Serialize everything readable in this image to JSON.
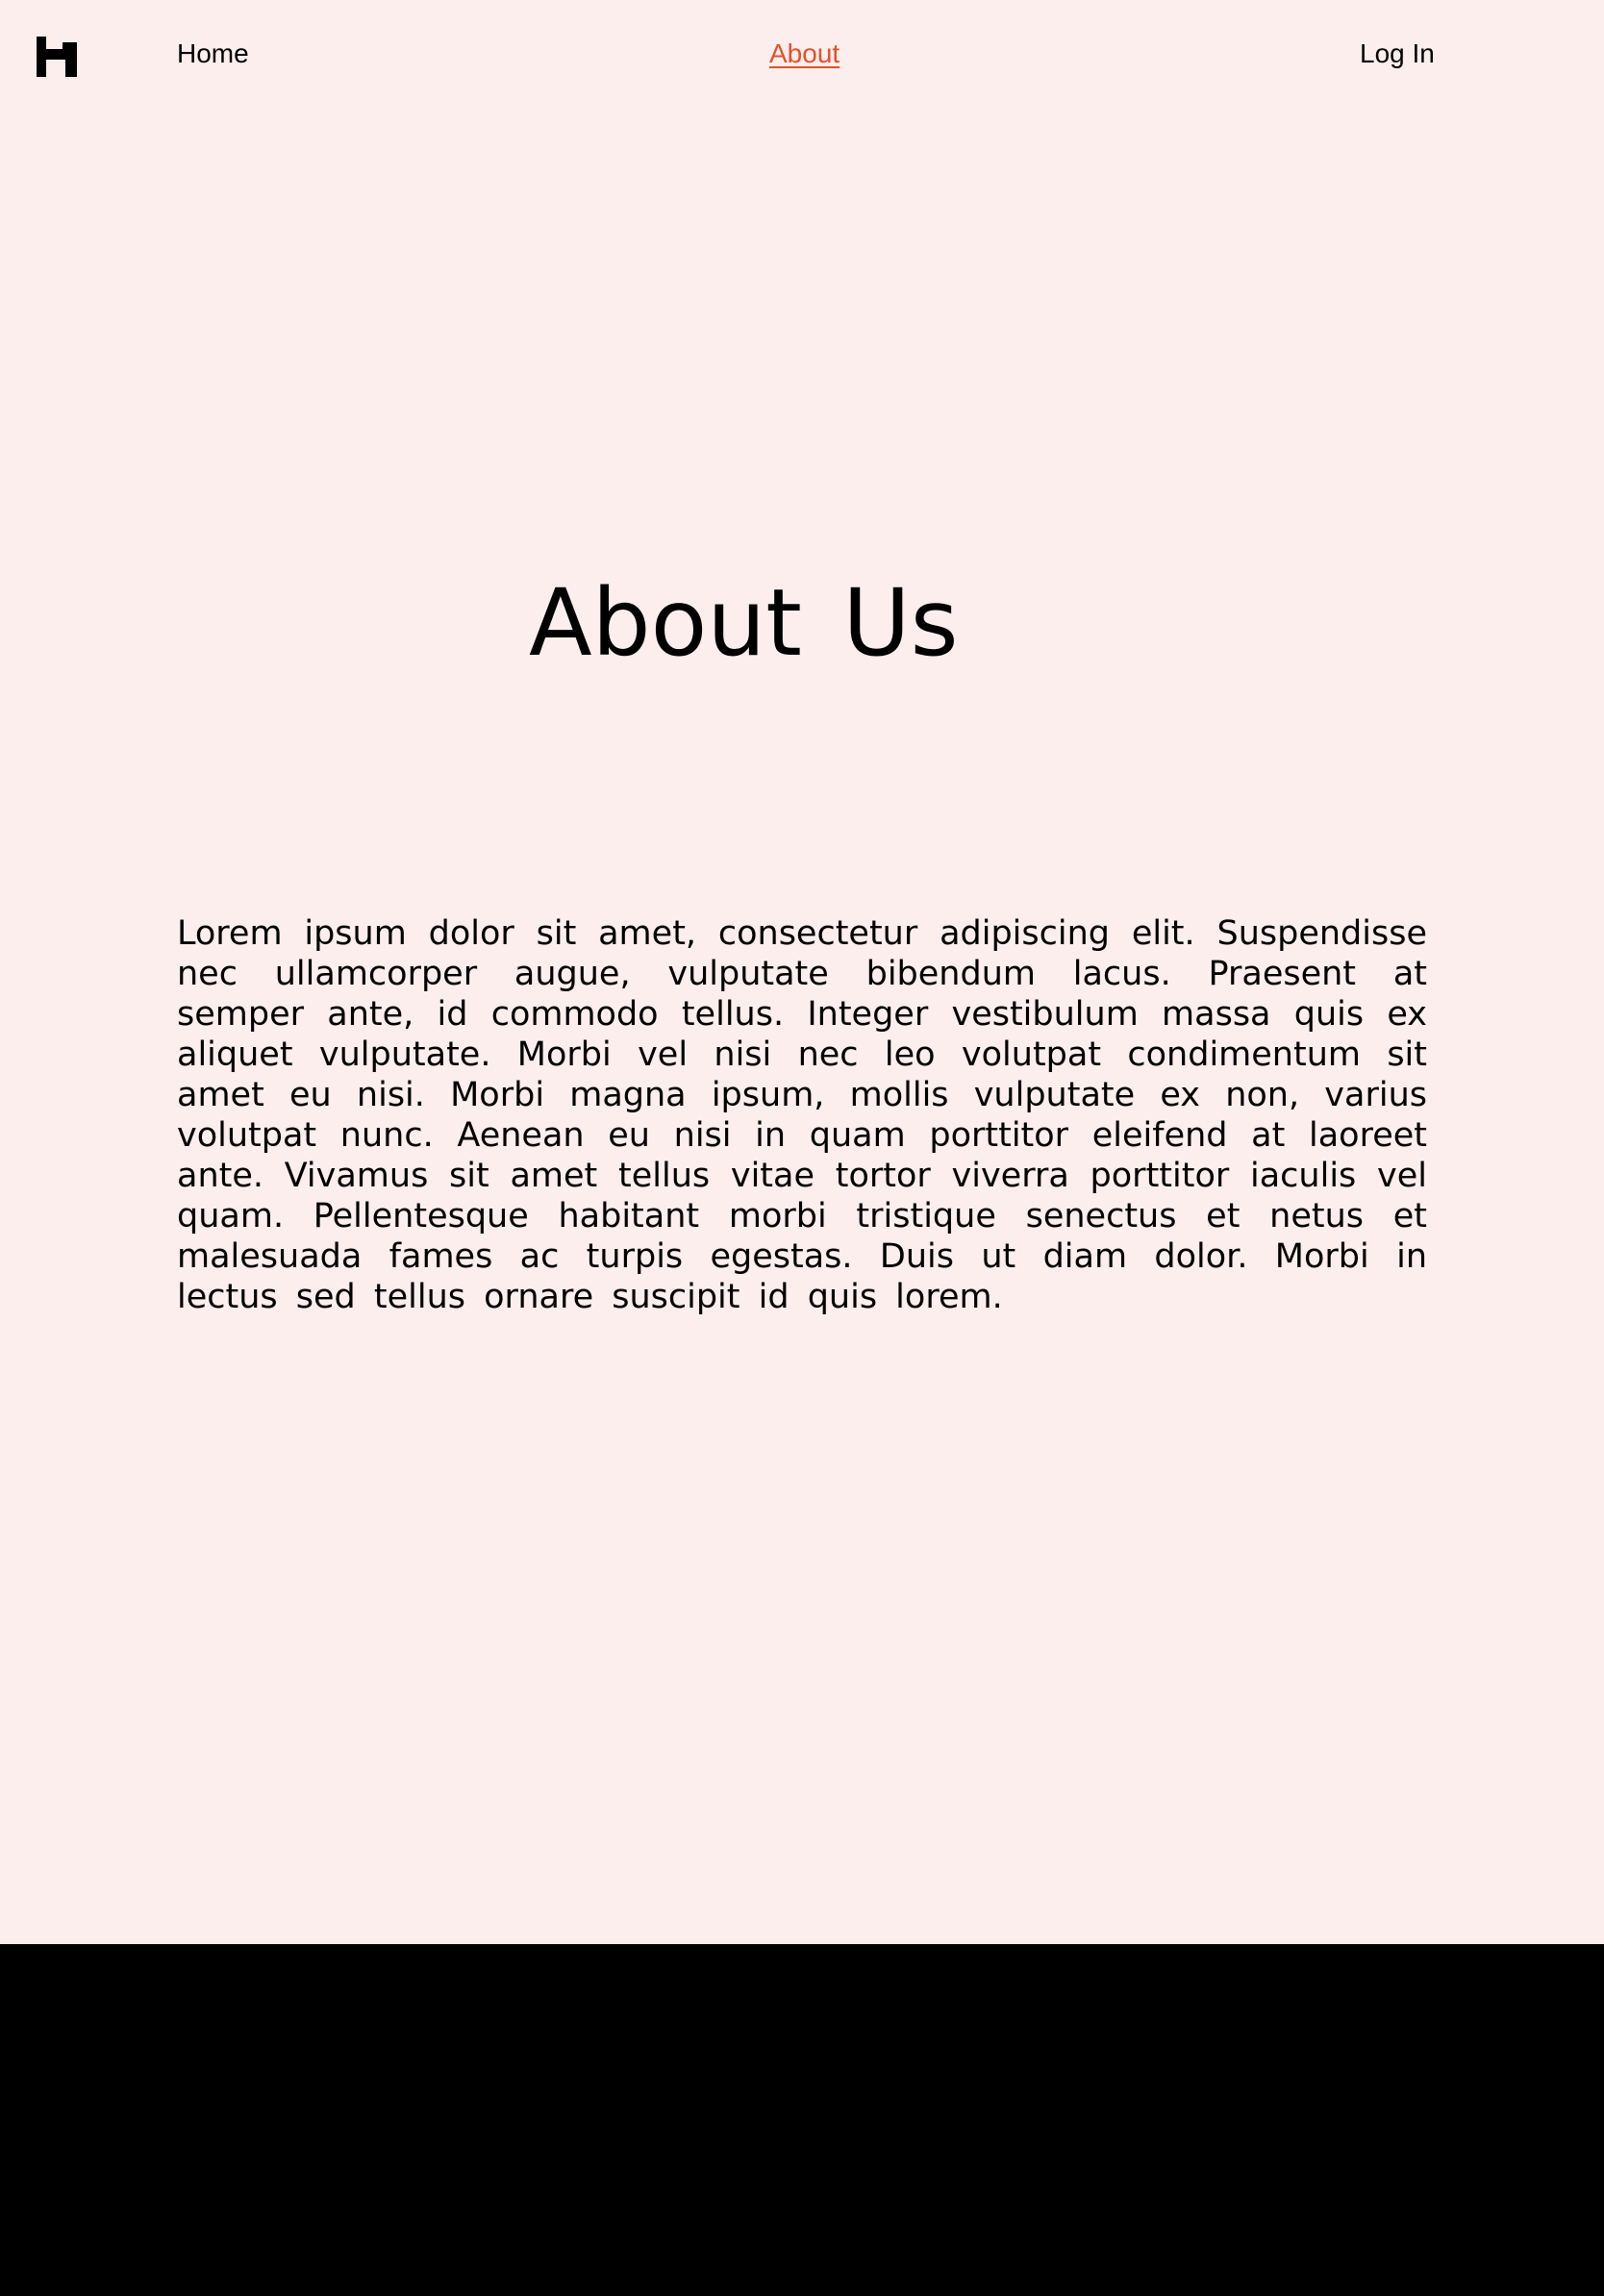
{
  "nav": {
    "logo_icon": "logo-h-icon",
    "home_label": "Home",
    "about_label": "About",
    "login_label": "Log In"
  },
  "main": {
    "title": "About  Us",
    "paragraph": "Lorem ipsum dolor sit amet, consectetur adipiscing elit. Suspendisse nec ullamcorper augue, vulputate bibendum lacus. Praesent at semper ante, id commodo tellus. Integer vestibulum massa quis ex aliquet vulputate. Morbi vel nisi nec leo volutpat condimentum sit amet eu nisi. Morbi magna ipsum, mollis vulputate ex non, varius volutpat nunc. Aenean eu nisi in quam porttitor eleifend at laoreet ante. Vivamus sit amet tellus vitae tortor viverra porttitor iaculis vel quam. Pellentesque habitant morbi tristique senectus et netus et malesuada fames ac turpis egestas. Duis ut diam dolor. Morbi in lectus sed tellus ornare suscipit id quis lorem."
  },
  "colors": {
    "background": "#fdeeee",
    "text": "#000000",
    "active_link": "#e0522a",
    "footer": "#000000"
  }
}
